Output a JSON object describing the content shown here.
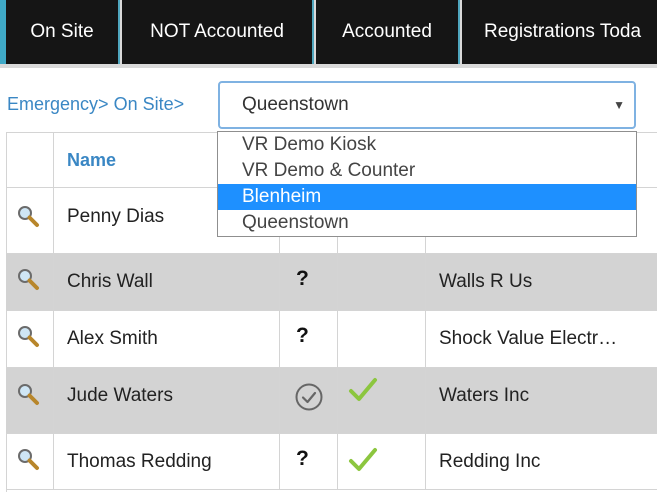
{
  "tabs": [
    {
      "label": "On Site"
    },
    {
      "label": "NOT Accounted"
    },
    {
      "label": "Accounted"
    },
    {
      "label": "Registrations Toda"
    }
  ],
  "breadcrumb": {
    "part1": "Emergency>",
    "part2": "On Site>"
  },
  "location_select": {
    "selected": "Queenstown",
    "options": [
      "VR Demo Kiosk",
      "VR Demo & Counter",
      "Blenheim",
      "Queenstown"
    ],
    "highlighted_option": "Blenheim"
  },
  "table": {
    "name_header": "Name",
    "rows": [
      {
        "name": "Penny Dias",
        "status": "",
        "checked": false,
        "company": ""
      },
      {
        "name": "Chris Wall",
        "status": "?",
        "checked": false,
        "company": "Walls R Us"
      },
      {
        "name": "Alex Smith",
        "status": "?",
        "checked": false,
        "company": "Shock Value Electr…"
      },
      {
        "name": "Jude Waters",
        "status": "accounted",
        "checked": true,
        "company": "Waters Inc"
      },
      {
        "name": "Thomas Redding",
        "status": "?",
        "checked": true,
        "company": "Redding Inc"
      }
    ]
  },
  "colors": {
    "tab_bg": "#151515",
    "accent_blue": "#3fa9c7",
    "link_blue": "#3a87c4",
    "highlight": "#1e90ff",
    "check_green": "#8cc63f",
    "row_shade": "#d3d3d3"
  },
  "icons": {
    "view": "magnifier-icon",
    "unknown": "question-mark-icon",
    "accounted": "circle-check-icon",
    "confirmed": "green-check-icon"
  }
}
